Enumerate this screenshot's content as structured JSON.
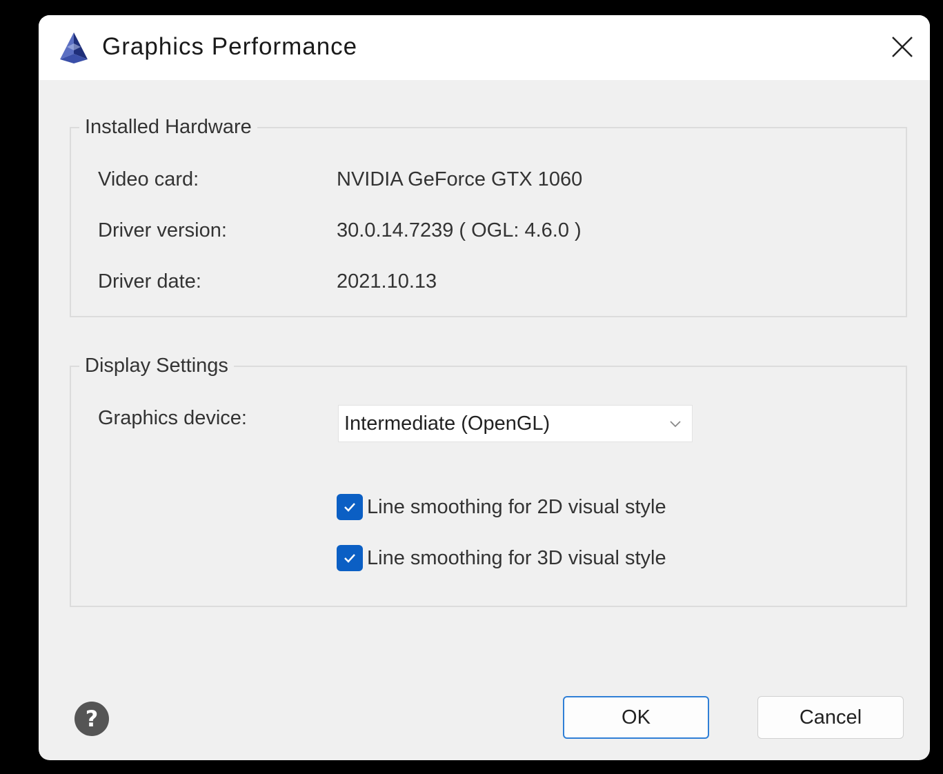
{
  "window": {
    "title": "Graphics Performance",
    "app_icon": "autocad-pyramid-icon",
    "close_icon": "close-icon"
  },
  "installed_hardware": {
    "legend": "Installed Hardware",
    "rows": [
      {
        "label": "Video card:",
        "value": "NVIDIA GeForce GTX 1060"
      },
      {
        "label": "Driver version:",
        "value": "30.0.14.7239 ( OGL: 4.6.0 )"
      },
      {
        "label": "Driver date:",
        "value": "2021.10.13"
      }
    ]
  },
  "display_settings": {
    "legend": "Display Settings",
    "graphics_device_label": "Graphics device:",
    "graphics_device_value": "Intermediate (OpenGL)",
    "checkboxes": [
      {
        "label": "Line smoothing for 2D visual style",
        "checked": true
      },
      {
        "label": "Line smoothing for 3D visual style",
        "checked": true
      }
    ]
  },
  "footer": {
    "help_icon": "help-icon",
    "help_glyph": "?",
    "ok_label": "OK",
    "cancel_label": "Cancel"
  },
  "colors": {
    "accent": "#0b5fc4",
    "ok_border": "#2f7fd6",
    "dialog_bg": "#f0f0f0",
    "titlebar_bg": "#ffffff"
  }
}
